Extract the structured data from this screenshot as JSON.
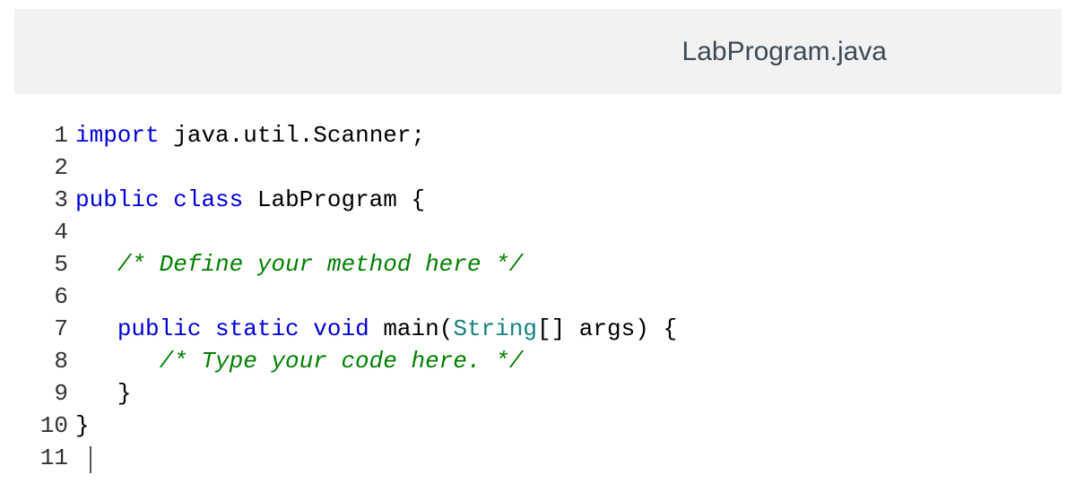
{
  "header": {
    "filename": "LabProgram.java"
  },
  "editor": {
    "lineNumbers": [
      "1",
      "2",
      "3",
      "4",
      "5",
      "6",
      "7",
      "8",
      "9",
      "10",
      "11"
    ],
    "lines": {
      "l1": {
        "kw1": "import",
        "sp1": " ",
        "p1": "java",
        "dot1": ".",
        "p2": "util",
        "dot2": ".",
        "p3": "Scanner",
        "semi": ";"
      },
      "l2": "",
      "l3": {
        "kw1": "public",
        "sp1": " ",
        "kw2": "class",
        "sp2": " ",
        "name": "LabProgram",
        "sp3": " ",
        "brace": "{"
      },
      "l4": "",
      "l5": {
        "indent": "   ",
        "comment": "/* Define your method here */"
      },
      "l6": "",
      "l7": {
        "indent": "   ",
        "kw1": "public",
        "sp1": " ",
        "kw2": "static",
        "sp2": " ",
        "kw3": "void",
        "sp3": " ",
        "name": "main",
        "paren1": "(",
        "type": "String",
        "brackets": "[]",
        "sp4": " ",
        "arg": "args",
        "paren2": ")",
        "sp5": " ",
        "brace": "{"
      },
      "l8": {
        "indent": "      ",
        "comment": "/* Type your code here. */"
      },
      "l9": {
        "indent": "   ",
        "brace": "}"
      },
      "l10": {
        "brace": "}"
      },
      "l11": ""
    }
  }
}
